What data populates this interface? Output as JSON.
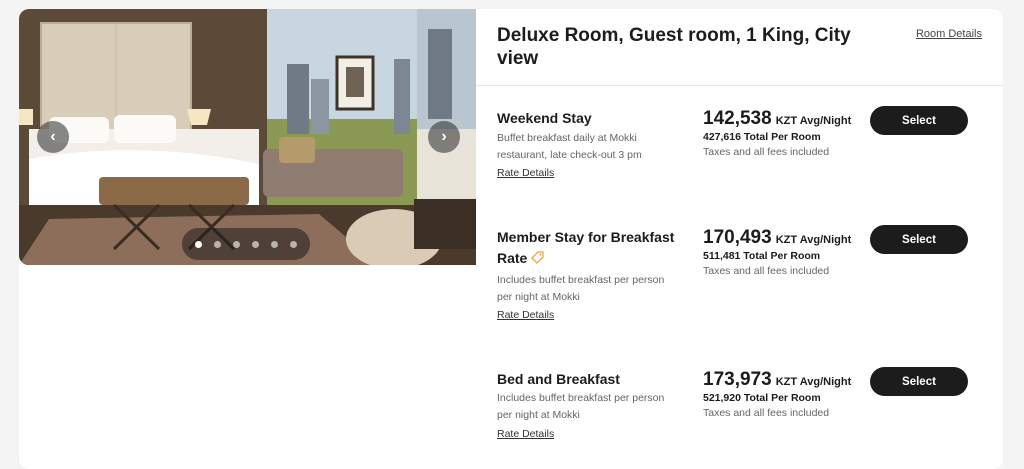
{
  "room": {
    "title": "Deluxe Room, Guest room, 1 King, City view",
    "details_link": "Room Details"
  },
  "gallery": {
    "prev_icon": "chevron-left-icon",
    "next_icon": "chevron-right-icon",
    "dot_count": 6,
    "active_dot": 1
  },
  "rates": [
    {
      "name": "Weekend Stay",
      "description": "Buffet breakfast daily at Mokki restaurant, late check-out 3 pm",
      "details_link": "Rate Details",
      "price": "142,538",
      "price_unit": "KZT Avg/Night",
      "total": "427,616 Total Per Room",
      "fees": "Taxes and all fees included",
      "select_label": "Select",
      "has_tag": false
    },
    {
      "name": "Member Stay for Breakfast Rate",
      "description": "Includes buffet breakfast per person per night at Mokki",
      "details_link": "Rate Details",
      "price": "170,493",
      "price_unit": "KZT Avg/Night",
      "total": "511,481 Total Per Room",
      "fees": "Taxes and all fees included",
      "select_label": "Select",
      "has_tag": true
    },
    {
      "name": "Bed and Breakfast",
      "description": "Includes buffet breakfast per person per night at Mokki",
      "details_link": "Rate Details",
      "price": "173,973",
      "price_unit": "KZT Avg/Night",
      "total": "521,920 Total Per Room",
      "fees": "Taxes and all fees included",
      "select_label": "Select",
      "has_tag": false
    }
  ],
  "colors": {
    "button": "#1c1c1c",
    "tag": "#f0a14a"
  }
}
